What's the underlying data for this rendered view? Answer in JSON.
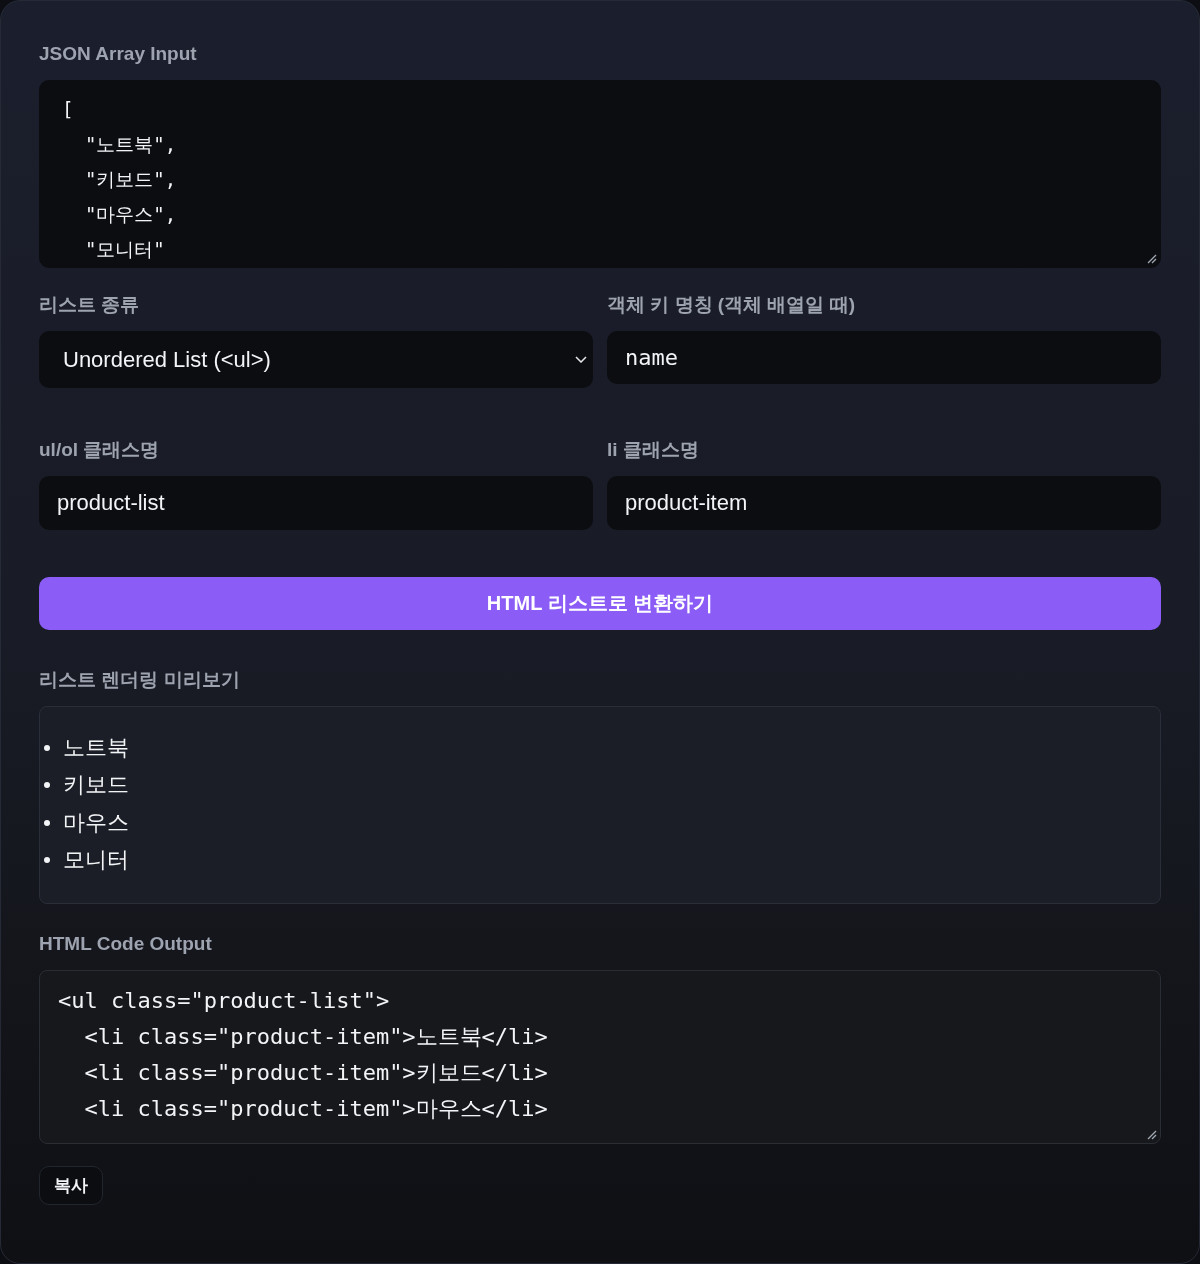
{
  "json_input": {
    "label": "JSON Array Input",
    "lines": [
      "[",
      "  \"노트북\",",
      "  \"키보드\",",
      "  \"마우스\",",
      "  \"모니터\""
    ]
  },
  "fields": [
    {
      "kind": "select",
      "label": "리스트 종류",
      "value": "Unordered List (<ul>)"
    },
    {
      "kind": "code",
      "label": "객체 키 명칭 (객체 배열일 때)",
      "value": "name"
    },
    {
      "kind": "text",
      "label": "ul/ol 클래스명",
      "value": "product-list"
    },
    {
      "kind": "text",
      "label": "li 클래스명",
      "value": "product-item"
    }
  ],
  "convert_button": "HTML 리스트로 변환하기",
  "preview": {
    "label": "리스트 렌더링 미리보기",
    "items": [
      "노트북",
      "키보드",
      "마우스",
      "모니터"
    ]
  },
  "output": {
    "label": "HTML Code Output",
    "lines": [
      "<ul class=\"product-list\">",
      "  <li class=\"product-item\">노트북</li>",
      "  <li class=\"product-item\">키보드</li>",
      "  <li class=\"product-item\">마우스</li>"
    ]
  },
  "copy_button": "복사"
}
